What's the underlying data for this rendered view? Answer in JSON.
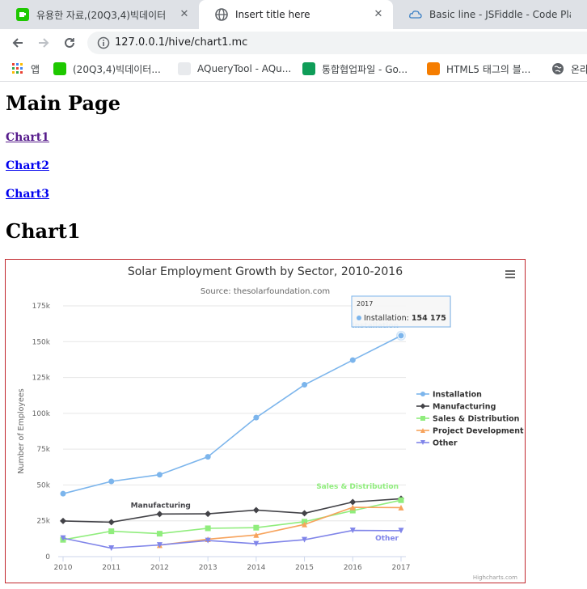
{
  "browser": {
    "tabs": [
      {
        "title": "유용한 자료,(20Q3,4)빅데이터"
      },
      {
        "title": "Insert title here"
      },
      {
        "title": "Basic line - JSFiddle - Code Playground"
      }
    ],
    "url": "127.0.0.1/hive/chart1.mc",
    "bookmarks": [
      {
        "label": "앱"
      },
      {
        "label": "(20Q3,4)빅데이터..."
      },
      {
        "label": "AQueryTool - AQu..."
      },
      {
        "label": "통합협업파일 - Go..."
      },
      {
        "label": "HTML5 태그의 블..."
      },
      {
        "label": "온라"
      }
    ]
  },
  "page": {
    "heading": "Main Page",
    "links": [
      "Chart1",
      "Chart2",
      "Chart3"
    ],
    "section_title": "Chart1"
  },
  "chart_data": {
    "type": "line",
    "title": "Solar Employment Growth by Sector, 2010-2016",
    "subtitle": "Source: thesolarfoundation.com",
    "ylabel": "Number of Employees",
    "xlabel": "",
    "x": [
      2010,
      2011,
      2012,
      2013,
      2014,
      2015,
      2016,
      2017
    ],
    "ylim": [
      0,
      175000
    ],
    "yticks": [
      0,
      25000,
      50000,
      75000,
      100000,
      125000,
      150000,
      175000
    ],
    "ytick_labels": [
      "0",
      "25k",
      "50k",
      "75k",
      "100k",
      "125k",
      "150k",
      "175k"
    ],
    "grid": true,
    "legend_position": "right-middle",
    "credits": "Highcharts.com",
    "series": [
      {
        "name": "Installation",
        "color": "#7cb5ec",
        "marker": "circle",
        "values": [
          43934,
          52503,
          57177,
          69658,
          97031,
          119931,
          137133,
          154175
        ]
      },
      {
        "name": "Manufacturing",
        "color": "#434348",
        "marker": "diamond",
        "values": [
          24916,
          24064,
          29742,
          29851,
          32490,
          30282,
          38121,
          40434
        ]
      },
      {
        "name": "Sales & Distribution",
        "color": "#90ed7d",
        "marker": "square",
        "values": [
          11744,
          17722,
          16005,
          19771,
          20185,
          24377,
          32147,
          39387
        ]
      },
      {
        "name": "Project Development",
        "color": "#f7a35c",
        "marker": "triangle",
        "values": [
          null,
          null,
          7988,
          12169,
          15112,
          22452,
          34400,
          34227
        ]
      },
      {
        "name": "Other",
        "color": "#8085e9",
        "marker": "triangle-down",
        "values": [
          12908,
          5948,
          8105,
          11248,
          8989,
          11816,
          18274,
          18111
        ]
      }
    ],
    "series_labels": [
      "Installation",
      "Manufacturing",
      "Sales & Distribution",
      "Other"
    ],
    "tooltip": {
      "header": "2017",
      "series": "Installation:",
      "value": "154 175"
    },
    "menu_icon": "hamburger-icon"
  }
}
